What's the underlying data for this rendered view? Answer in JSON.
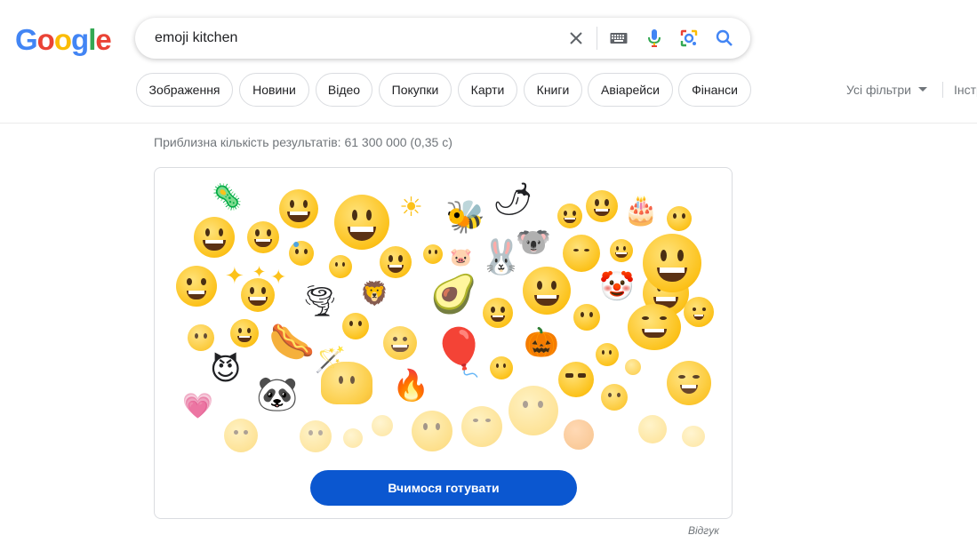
{
  "logo": {
    "letters": [
      "G",
      "o",
      "o",
      "g",
      "l",
      "e"
    ],
    "colors": [
      "#4285f4",
      "#ea4335",
      "#fbbc05",
      "#4285f4",
      "#34a853",
      "#ea4335"
    ]
  },
  "search": {
    "query": "emoji kitchen",
    "icons": [
      "clear-icon",
      "keyboard-icon",
      "mic-icon",
      "lens-icon",
      "search-icon"
    ]
  },
  "filters": {
    "chips": [
      "Зображення",
      "Новини",
      "Відео",
      "Покупки",
      "Карти",
      "Книги",
      "Авіарейси",
      "Фінанси"
    ],
    "all_filters": "Усі фільтри",
    "tools": "Інструменти"
  },
  "stats": "Приблизна кількість результатів: 61 300 000 (0,35 с)",
  "card": {
    "button_label": "Вчимося готувати",
    "emoji_glyphs": [
      "🦠",
      "🌶",
      "🐝",
      "🎂",
      "🐨",
      "🐷",
      "🐰",
      "🥑",
      "🦁",
      "🌪",
      "🌭",
      "🔥",
      "🎈",
      "🎃",
      "🐼",
      "💗",
      "😈",
      "🤡",
      "🪄"
    ]
  },
  "feedback": "Відгук",
  "colors": {
    "accent": "#0b57d0",
    "chip_border": "#dadce0",
    "muted_text": "#70757a"
  }
}
